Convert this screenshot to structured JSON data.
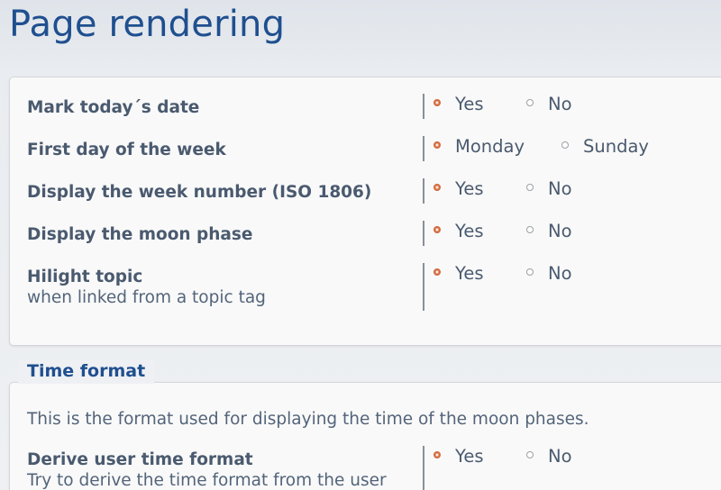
{
  "page": {
    "title": "Page rendering"
  },
  "settings": [
    {
      "label": "Mark today´s date",
      "sublabel": "",
      "options": [
        "Yes",
        "No"
      ],
      "selected": "Yes"
    },
    {
      "label": "First day of the week",
      "sublabel": "",
      "options": [
        "Monday",
        "Sunday"
      ],
      "selected": "Monday"
    },
    {
      "label": "Display the week number (ISO 1806)",
      "sublabel": "",
      "options": [
        "Yes",
        "No"
      ],
      "selected": "Yes"
    },
    {
      "label": "Display the moon phase",
      "sublabel": "",
      "options": [
        "Yes",
        "No"
      ],
      "selected": "Yes"
    },
    {
      "label": "Hilight topic",
      "sublabel": "when linked from a topic tag",
      "options": [
        "Yes",
        "No"
      ],
      "selected": "Yes"
    }
  ],
  "time_format": {
    "title": "Time format",
    "description": "This is the format used for displaying the time of the moon phases.",
    "settings": [
      {
        "label": "Derive user time format",
        "sublabel": "Try to derive the time format from the user",
        "options": [
          "Yes",
          "No"
        ],
        "selected": "Yes"
      }
    ]
  },
  "colors": {
    "title": "#1f4f8f",
    "text": "#4a5a6f",
    "radio_selected": "#d26b3e"
  }
}
